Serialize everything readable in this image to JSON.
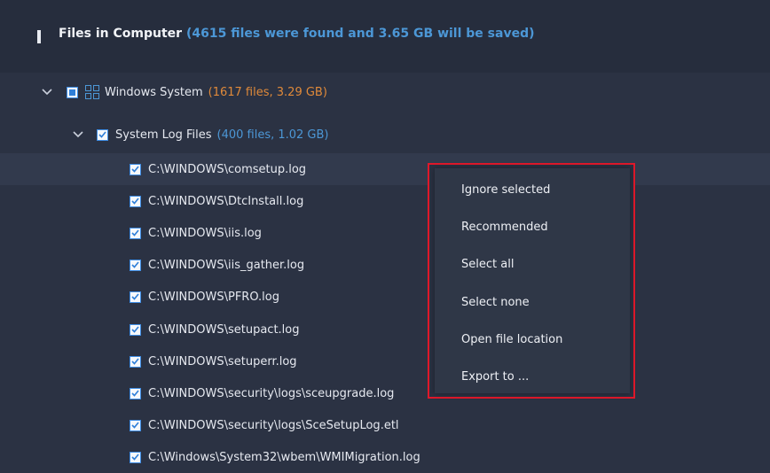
{
  "header": {
    "title": "Files in Computer",
    "summary": "(4615 files were found and 3.65 GB will be saved)"
  },
  "tree": {
    "category": {
      "label": "Windows System",
      "meta": "(1617 files, 3.29 GB)",
      "state": "partial"
    },
    "group": {
      "label": "System Log Files",
      "meta": "(400 files, 1.02 GB)",
      "checked": true
    },
    "files": [
      "C:\\WINDOWS\\comsetup.log",
      "C:\\WINDOWS\\DtcInstall.log",
      "C:\\WINDOWS\\iis.log",
      "C:\\WINDOWS\\iis_gather.log",
      "C:\\WINDOWS\\PFRO.log",
      "C:\\WINDOWS\\setupact.log",
      "C:\\WINDOWS\\setuperr.log",
      "C:\\WINDOWS\\security\\logs\\sceupgrade.log",
      "C:\\WINDOWS\\security\\logs\\SceSetupLog.etl",
      "C:\\Windows\\System32\\wbem\\WMIMigration.log"
    ]
  },
  "context_menu": {
    "items": [
      "Ignore selected",
      "Recommended",
      "Select all",
      "Select none",
      "Open file location",
      "Export to ..."
    ],
    "highlight_color": "#e0182a"
  },
  "colors": {
    "accent_blue": "#4c97d6",
    "accent_orange": "#e08a3a",
    "checkbox_blue": "#2f7fd8"
  }
}
